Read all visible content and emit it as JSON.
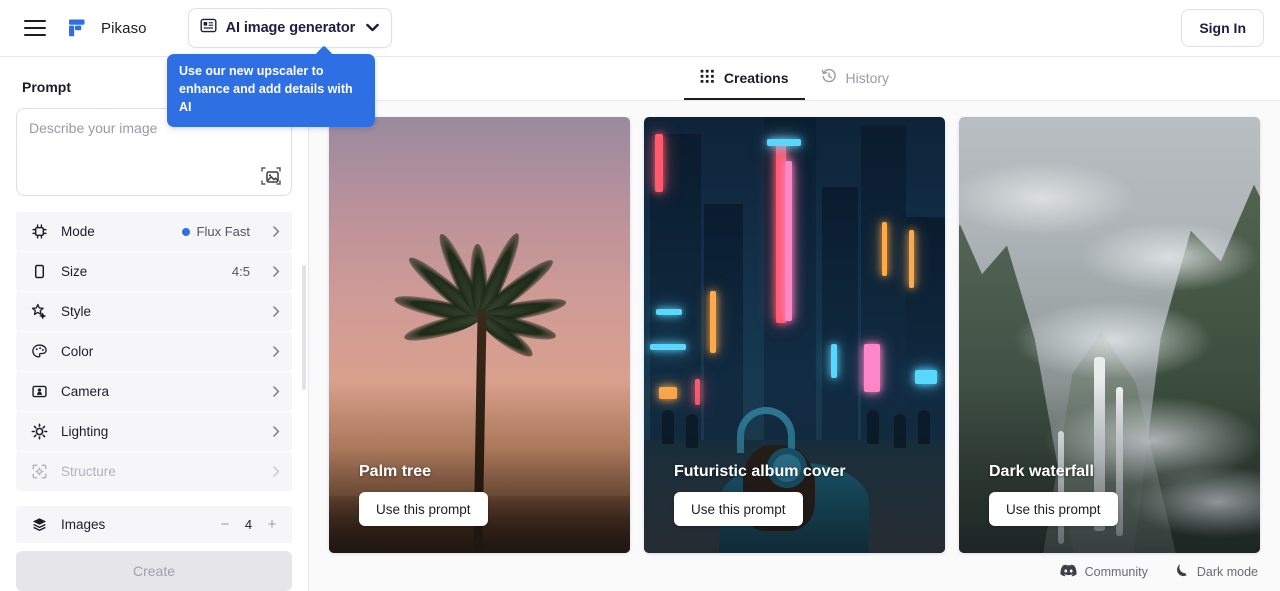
{
  "topbar": {
    "menu_icon": "hamburger-icon",
    "logo_icon": "freepik-logo-icon",
    "brand_name": "Pikaso",
    "product_switcher": {
      "icon": "ai-image-generator-icon",
      "label": "AI image generator",
      "caret_icon": "chevron-down-icon"
    },
    "sign_in_label": "Sign In"
  },
  "tooltip": {
    "text": "Use our new upscaler to enhance and add details with AI",
    "color": "#2f6fe4"
  },
  "sidebar": {
    "prompt_heading": "Prompt",
    "prompt_value": "",
    "prompt_placeholder": "Describe your image",
    "image_upload_icon": "image-upload-icon",
    "options": [
      {
        "icon": "chip-icon",
        "label": "Mode",
        "value": "Flux Fast",
        "has_dot": true,
        "dot_color": "#2f6fe4",
        "disabled": false
      },
      {
        "icon": "rectangle-icon",
        "label": "Size",
        "value": "4:5",
        "has_dot": false,
        "disabled": false
      },
      {
        "icon": "sparkle-star-icon",
        "label": "Style",
        "value": "",
        "has_dot": false,
        "disabled": false
      },
      {
        "icon": "palette-icon",
        "label": "Color",
        "value": "",
        "has_dot": false,
        "disabled": false
      },
      {
        "icon": "camera-frame-icon",
        "label": "Camera",
        "value": "",
        "has_dot": false,
        "disabled": false
      },
      {
        "icon": "sun-icon",
        "label": "Lighting",
        "value": "",
        "has_dot": false,
        "disabled": false
      },
      {
        "icon": "structure-icon",
        "label": "Structure",
        "value": "",
        "has_dot": false,
        "disabled": true
      }
    ],
    "images_row": {
      "icon": "layers-icon",
      "label": "Images",
      "decrement": "−",
      "count": "4",
      "increment": "+"
    },
    "create_label": "Create"
  },
  "main": {
    "tabs": [
      {
        "label": "Creations",
        "icon": "grid-icon",
        "active": true
      },
      {
        "label": "History",
        "icon": "history-clock-icon",
        "active": false
      }
    ],
    "cards": [
      {
        "title": "Palm tree",
        "button_label": "Use this prompt",
        "art": "palm"
      },
      {
        "title": "Futuristic album cover",
        "button_label": "Use this prompt",
        "art": "city"
      },
      {
        "title": "Dark waterfall",
        "button_label": "Use this prompt",
        "art": "water"
      }
    ],
    "footer": [
      {
        "label": "Community",
        "icon": "discord-icon"
      },
      {
        "label": "Dark mode",
        "icon": "moon-icon"
      }
    ]
  }
}
